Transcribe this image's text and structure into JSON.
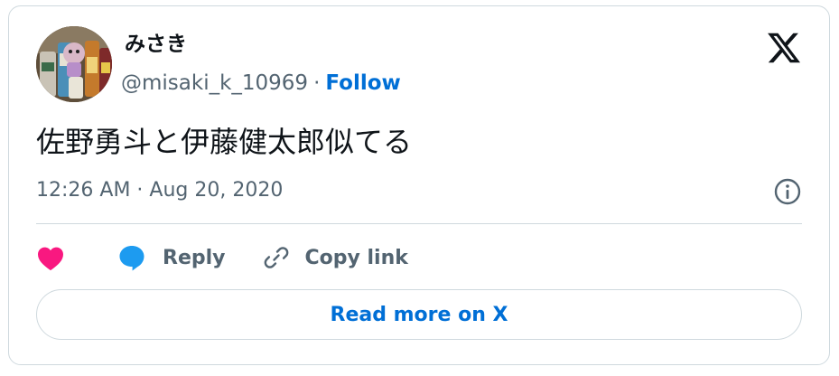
{
  "author": {
    "display_name": "みさき",
    "handle": "@misaki_k_10969",
    "separator": "·",
    "follow_label": "Follow"
  },
  "brand": {
    "logo_icon": "x-logo-icon"
  },
  "tweet": {
    "text": "佐野勇斗と伊藤健太郎似てる",
    "timestamp": "12:26 AM · Aug 20, 2020"
  },
  "actions": {
    "like_icon": "heart-icon",
    "reply_icon": "speech-bubble-icon",
    "reply_label": "Reply",
    "copy_icon": "link-icon",
    "copy_label": "Copy link",
    "info_icon": "info-icon"
  },
  "footer": {
    "read_more_label": "Read more on X"
  },
  "colors": {
    "text": "#0f1419",
    "secondary_text": "#536471",
    "link_blue": "#006fd6",
    "like_pink": "#f91880",
    "reply_blue": "#1d9bf0",
    "border": "#cfd9de"
  }
}
